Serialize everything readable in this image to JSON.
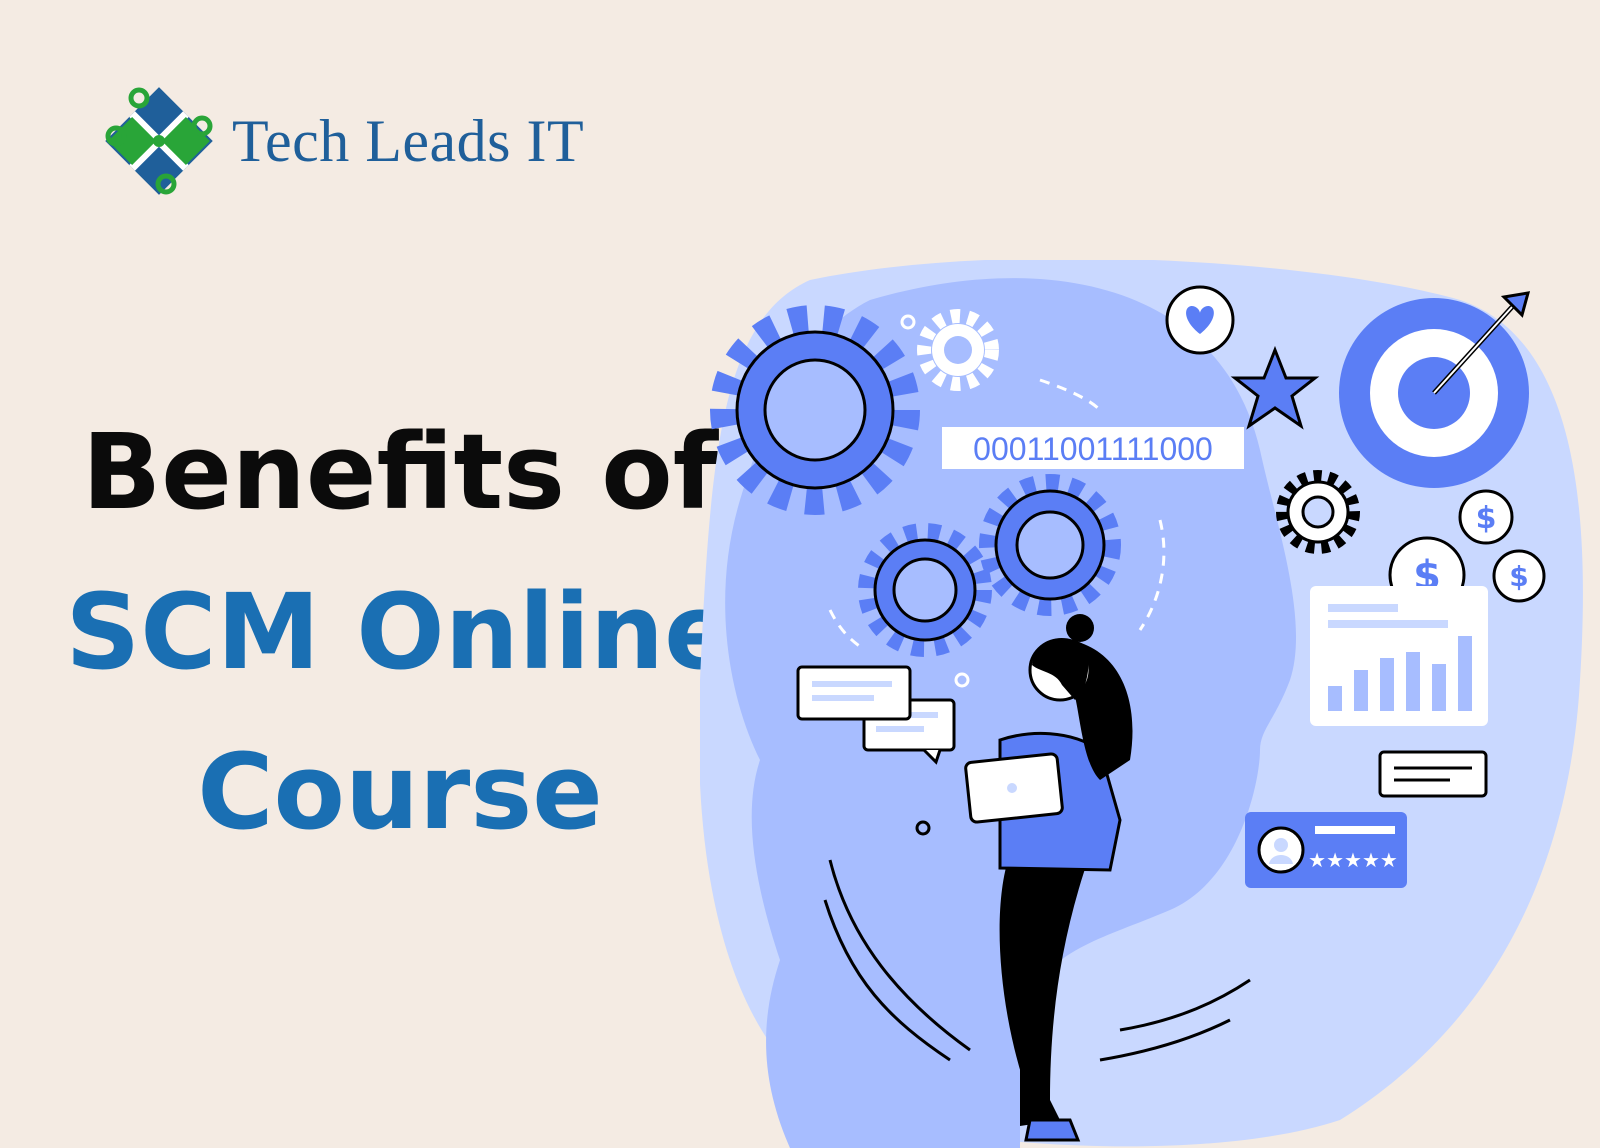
{
  "brand": {
    "name": "Tech Leads IT",
    "colors": {
      "blue": "#1f5f9a",
      "green": "#29a538"
    }
  },
  "headline": {
    "line1": "Benefits of",
    "line2": "SCM Online",
    "line3": "Course"
  },
  "illustration": {
    "binary_text": "00011001111000",
    "review_stars": "★★★★★",
    "currency_symbol": "$",
    "icons": [
      "gear-icon",
      "heart-icon",
      "star-icon",
      "target-icon",
      "dollar-icon",
      "bar-chart-icon",
      "chat-bubble-icon",
      "user-avatar-icon"
    ]
  },
  "colors": {
    "background": "#f4ebe3",
    "headline_dark": "#0b0b0b",
    "headline_blue": "#1a6fb3",
    "accent": "#5b7ef5",
    "pale_blue": "#c9d8ff",
    "mid_blue": "#a7bdff"
  }
}
